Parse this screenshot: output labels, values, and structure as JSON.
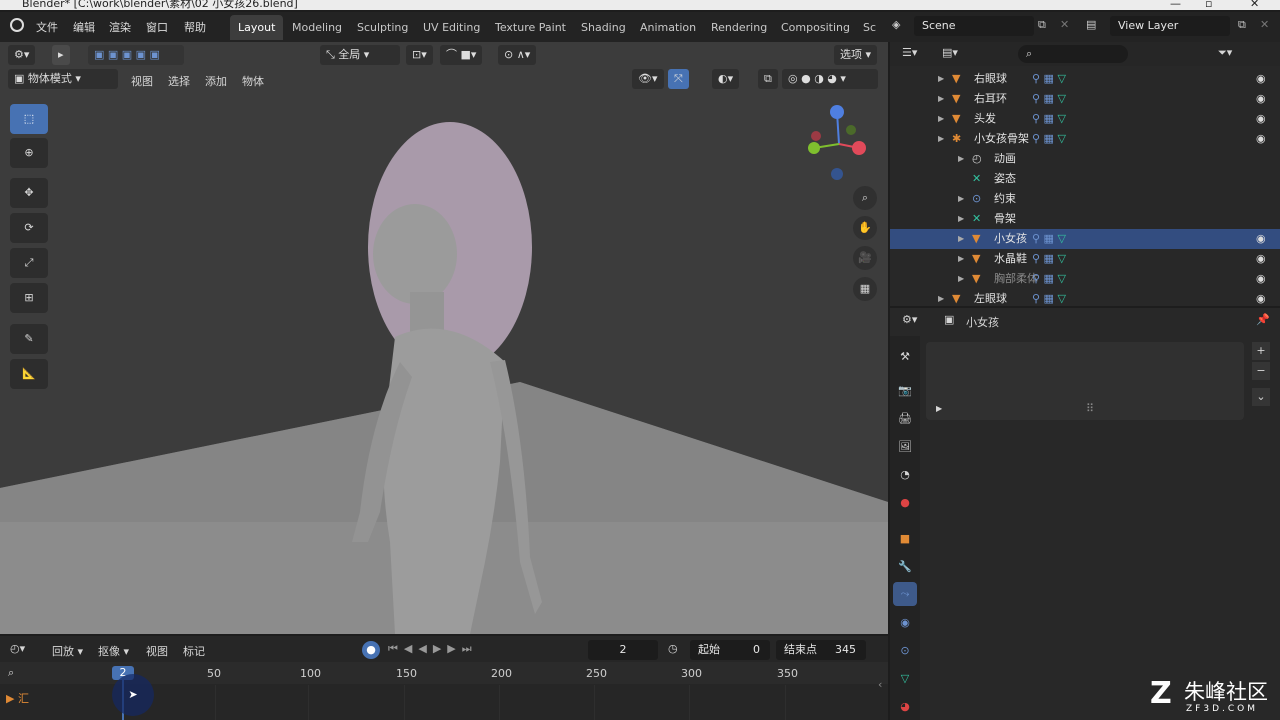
{
  "window": {
    "title": "Blender* [C:\\work\\blender\\素材\\02 小女孩26.blend]"
  },
  "menu": {
    "file": "文件",
    "edit": "编辑",
    "render": "渲染",
    "window": "窗口",
    "help": "帮助"
  },
  "workspaces": [
    "Layout",
    "Modeling",
    "Sculpting",
    "UV Editing",
    "Texture Paint",
    "Shading",
    "Animation",
    "Rendering",
    "Compositing",
    "Sc"
  ],
  "scene": {
    "name": "Scene",
    "view_layer": "View Layer"
  },
  "header": {
    "transform_orientation": "全局",
    "options_label": "选项",
    "mode": "物体模式",
    "view": "视图",
    "select": "选择",
    "add": "添加",
    "object": "物体"
  },
  "outliner": {
    "rows": [
      {
        "label": "右眼球",
        "selected": false,
        "dim": false
      },
      {
        "label": "右耳环",
        "selected": false,
        "dim": false
      },
      {
        "label": "头发",
        "selected": false,
        "dim": false
      },
      {
        "label": "小女孩骨架",
        "selected": false,
        "dim": false
      },
      {
        "label": "动画",
        "selected": false,
        "dim": false
      },
      {
        "label": "姿态",
        "selected": false,
        "dim": false
      },
      {
        "label": "约束",
        "selected": false,
        "dim": false
      },
      {
        "label": "骨架",
        "selected": false,
        "dim": false
      },
      {
        "label": "小女孩",
        "selected": true,
        "dim": false
      },
      {
        "label": "水晶鞋",
        "selected": false,
        "dim": false
      },
      {
        "label": "胸部柔体",
        "selected": false,
        "dim": true
      },
      {
        "label": "左眼球",
        "selected": false,
        "dim": false
      }
    ]
  },
  "properties": {
    "object_name": "小女孩"
  },
  "timeline": {
    "playback": "回放",
    "keying": "抠像",
    "view": "视图",
    "marker": "标记",
    "current_frame": "2",
    "start_label": "起始",
    "start": "0",
    "end_label": "结束点",
    "end": "345",
    "ticks": [
      "50",
      "100",
      "150",
      "200",
      "250",
      "300",
      "350"
    ],
    "playhead": "2"
  },
  "watermark": {
    "brand": "朱峰社区",
    "url": "ZF3D.COM"
  },
  "colors": {
    "accent": "#4772b3",
    "selection": "#334d80",
    "mesh_icon": "#e08a35",
    "data_icon": "#33c2a0"
  }
}
